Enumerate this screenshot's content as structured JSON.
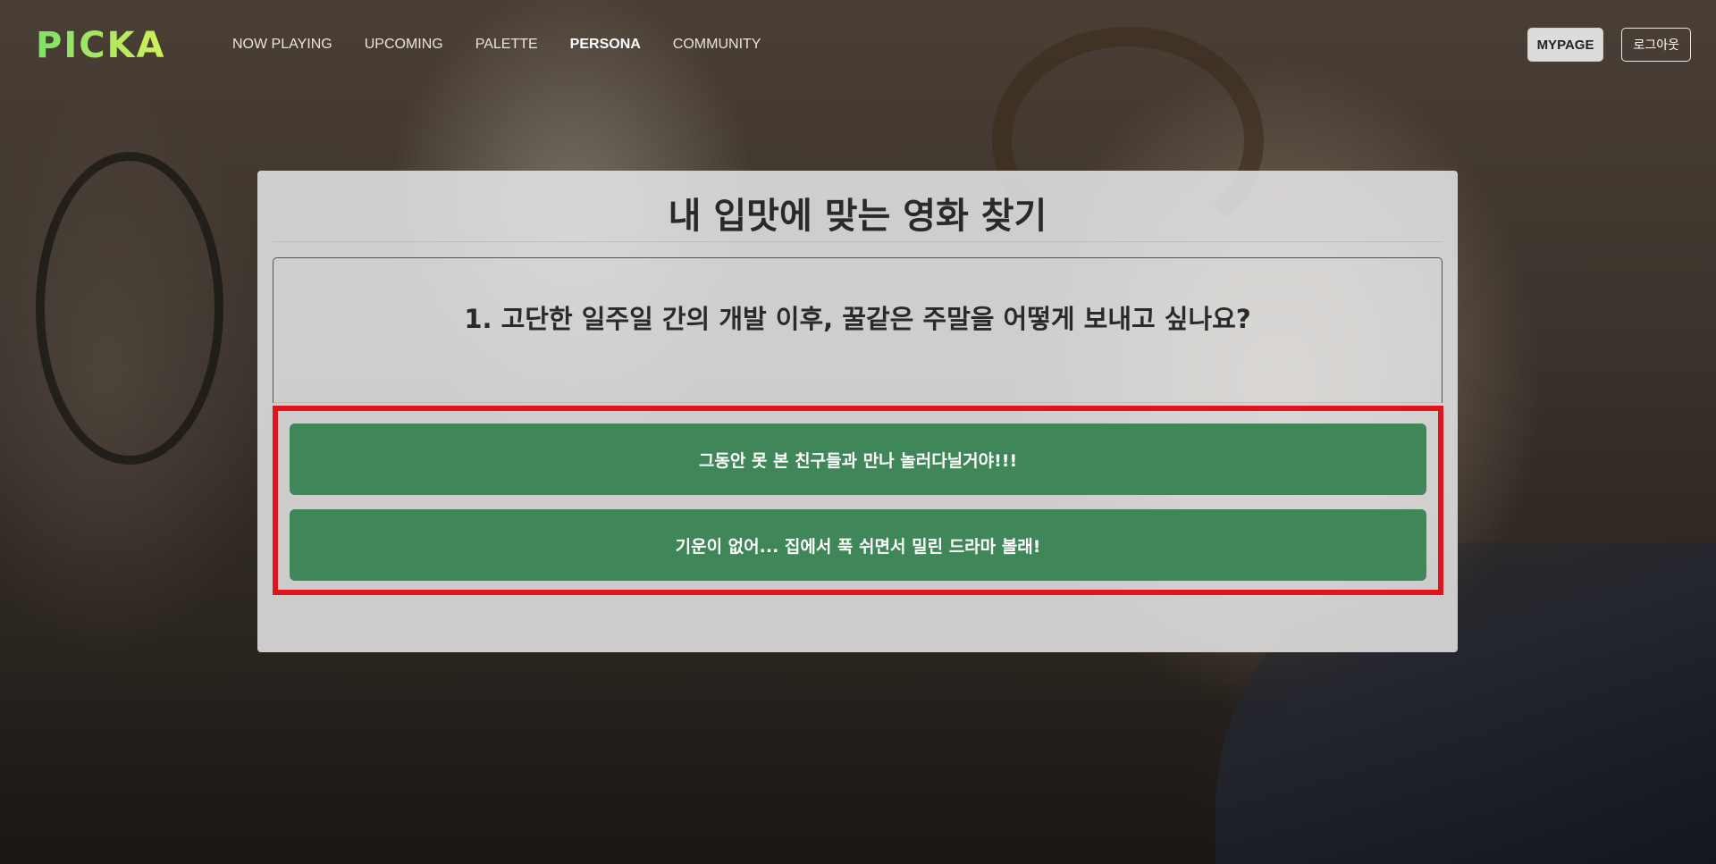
{
  "navbar": {
    "logo": "PICKA",
    "links": [
      {
        "label": "NOW PLAYING",
        "active": false
      },
      {
        "label": "UPCOMING",
        "active": false
      },
      {
        "label": "PALETTE",
        "active": false
      },
      {
        "label": "PERSONA",
        "active": true
      },
      {
        "label": "COMMUNITY",
        "active": false
      }
    ],
    "mypage_label": "MYPAGE",
    "logout_label": "로그아웃"
  },
  "quiz": {
    "title": "내 입맛에 맞는 영화 찾기",
    "question": "1. 고단한 일주일 간의 개발 이후, 꿀같은 주말을 어떻게 보내고 싶나요?",
    "answers": [
      "그동안 못 본 친구들과 만나 놀러다닐거야!!!",
      "기운이 없어... 집에서 푹 쉬면서 밀린 드라마 볼래!"
    ]
  },
  "colors": {
    "logo": "#b5e86a",
    "answer_button": "#3f8759",
    "highlight_frame": "#e0141e",
    "card_background": "#e8e8e8"
  }
}
